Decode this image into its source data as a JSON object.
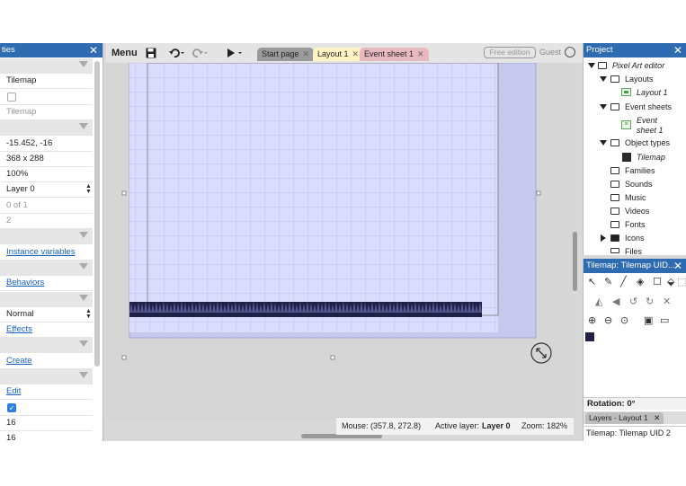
{
  "properties": {
    "title": "ties",
    "rows": [
      {
        "kind": "cat",
        "text": ""
      },
      {
        "kind": "value",
        "text": "Tilemap"
      },
      {
        "kind": "check",
        "checked": false
      },
      {
        "kind": "grey",
        "text": "Tilemap"
      },
      {
        "kind": "cat",
        "text": ""
      },
      {
        "kind": "value",
        "text": "-15.452, -16"
      },
      {
        "kind": "value",
        "text": "368 x 288"
      },
      {
        "kind": "value",
        "text": "100%"
      },
      {
        "kind": "select",
        "text": "Layer 0"
      },
      {
        "kind": "grey",
        "text": "0 of 1"
      },
      {
        "kind": "grey",
        "text": "2"
      },
      {
        "kind": "cat",
        "text": ""
      },
      {
        "kind": "link",
        "text": "Instance variables"
      },
      {
        "kind": "cat",
        "text": ""
      },
      {
        "kind": "link",
        "text": "Behaviors"
      },
      {
        "kind": "cat",
        "text": ""
      },
      {
        "kind": "select",
        "text": "Normal"
      },
      {
        "kind": "link",
        "text": "Effects"
      },
      {
        "kind": "cat",
        "text": ""
      },
      {
        "kind": "link",
        "text": "Create"
      },
      {
        "kind": "cat",
        "text": ""
      },
      {
        "kind": "link",
        "text": "Edit"
      },
      {
        "kind": "check",
        "checked": true
      },
      {
        "kind": "value",
        "text": "16"
      },
      {
        "kind": "value",
        "text": "16"
      }
    ]
  },
  "toolbar": {
    "menu_label": "Menu",
    "save_icon": "floppy-disk-icon",
    "undo_icon": "undo-icon",
    "redo_icon": "redo-icon",
    "play_icon": "play-icon",
    "tabs": [
      {
        "label": "Start page",
        "bg": "#9a9a9a",
        "active": false
      },
      {
        "label": "Layout 1",
        "bg": "#fff3c4",
        "active": true
      },
      {
        "label": "Event sheet 1",
        "bg": "#e8b9c0",
        "active": false
      }
    ],
    "edition_label": "Free edition",
    "user_label": "Guest"
  },
  "status": {
    "mouse": "Mouse: (357.8, 272.8)",
    "layer_prefix": "Active layer:",
    "layer_value": "Layer 0",
    "zoom": "Zoom: 182%"
  },
  "project": {
    "title": "Project",
    "root": "Pixel Art editor",
    "layouts": "Layouts",
    "layout1": "Layout 1",
    "event_sheets": "Event sheets",
    "event_sheet1": "Event sheet 1",
    "object_types": "Object types",
    "tilemap": "Tilemap",
    "families": "Families",
    "sounds": "Sounds",
    "music": "Music",
    "videos": "Videos",
    "fonts": "Fonts",
    "icons": "Icons",
    "files": "Files"
  },
  "tilemap_panel": {
    "title": "Tilemap: Tilemap UID...",
    "rotation": "Rotation: 0°",
    "layers_tab": "Layers - Layout 1",
    "footer": "Tilemap: Tilemap UID 2"
  },
  "colors": {
    "accent": "#2e6bb0",
    "layout_bg": "#c6c8ee",
    "grid_bg": "#dcdcff",
    "tile_dark": "#1f2148"
  }
}
